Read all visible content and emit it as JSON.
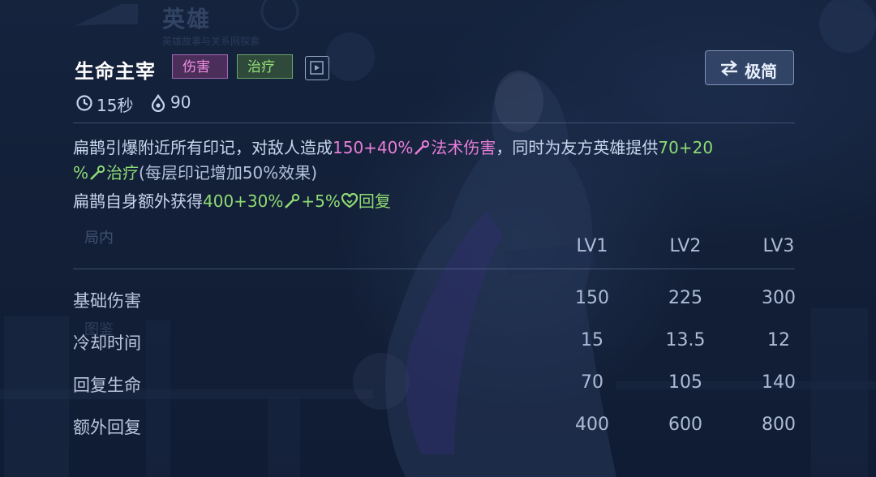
{
  "background": {
    "ghost_title": "英雄",
    "ghost_subtitle": "英雄故事与关系网探索",
    "ghost_tab_in_game": "局内",
    "ghost_tab_guide": "图鉴"
  },
  "skill": {
    "name": "生命主宰",
    "tags": [
      "伤害",
      "治疗"
    ],
    "cooldown": "15秒",
    "cost": "90"
  },
  "toolbar": {
    "simple_mode_label": "极简"
  },
  "description": {
    "line1_a": "扁鹊引爆附近所有印记，对敌人造成",
    "line1_magic_value": "150+40%",
    "line1_magic_type": "法术伤害",
    "line1_b": "，同时为友方英雄提供",
    "line1_heal_value": "70+20",
    "line2_heal_value": "%",
    "line2_heal_type": "治疗",
    "line2_note": "(每层印记增加50%效果)",
    "line3_a": "扁鹊自身额外获得",
    "line3_value1": "400+30%",
    "line3_value2": "+5%",
    "line3_type": "回复"
  },
  "table": {
    "columns": [
      "LV1",
      "LV2",
      "LV3"
    ],
    "rows": [
      {
        "label": "基础伤害",
        "values": [
          "150",
          "225",
          "300"
        ]
      },
      {
        "label": "冷却时间",
        "values": [
          "15",
          "13.5",
          "12"
        ]
      },
      {
        "label": "回复生命",
        "values": [
          "70",
          "105",
          "140"
        ]
      },
      {
        "label": "额外回复",
        "values": [
          "400",
          "600",
          "800"
        ]
      }
    ]
  },
  "colors": {
    "magic_damage": "#e87ed8",
    "heal": "#8edb73",
    "panel_bg": "#15223c"
  },
  "icons": {
    "cooldown": "clock-icon",
    "cost": "mana-drop-icon",
    "preview": "play-preview-icon",
    "simple_mode": "swap-arrows-icon",
    "spell_power": "magic-wand-icon",
    "heal_power": "heal-wand-icon",
    "regen": "heart-regen-icon"
  }
}
